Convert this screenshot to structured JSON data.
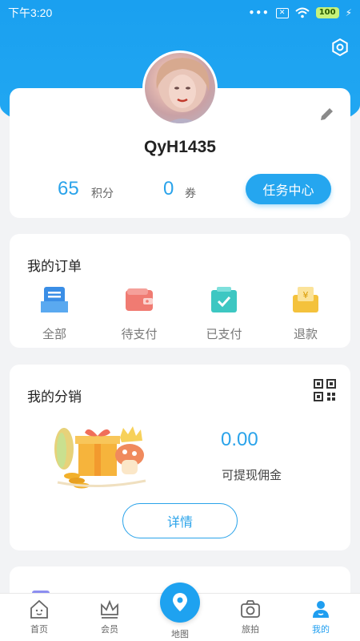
{
  "status_bar": {
    "time": "下午3:20",
    "battery": "100",
    "dots": "•••"
  },
  "profile": {
    "username": "QyH1435",
    "points_value": "65",
    "points_label": "积分",
    "coupons_value": "0",
    "coupons_label": "券",
    "task_center_label": "任务中心"
  },
  "orders": {
    "title": "我的订单",
    "items": [
      {
        "label": "全部",
        "icon": "all-orders-icon"
      },
      {
        "label": "待支付",
        "icon": "wallet-icon"
      },
      {
        "label": "已支付",
        "icon": "paid-bag-icon"
      },
      {
        "label": "退款",
        "icon": "refund-icon"
      }
    ]
  },
  "distribution": {
    "title": "我的分销",
    "amount": "0.00",
    "amount_label": "可提现佣金",
    "detail_label": "详情"
  },
  "bottom_nav": {
    "items": [
      {
        "label": "首页",
        "icon": "home-icon"
      },
      {
        "label": "会员",
        "icon": "crown-icon"
      },
      {
        "label": "地图",
        "icon": "map-pin-icon"
      },
      {
        "label": "旅拍",
        "icon": "camera-icon"
      },
      {
        "label": "我的",
        "icon": "user-icon"
      }
    ],
    "active": "我的"
  },
  "colors": {
    "accent": "#25a6ef",
    "header": "#1aa0f0",
    "background": "#f2f3f5"
  }
}
